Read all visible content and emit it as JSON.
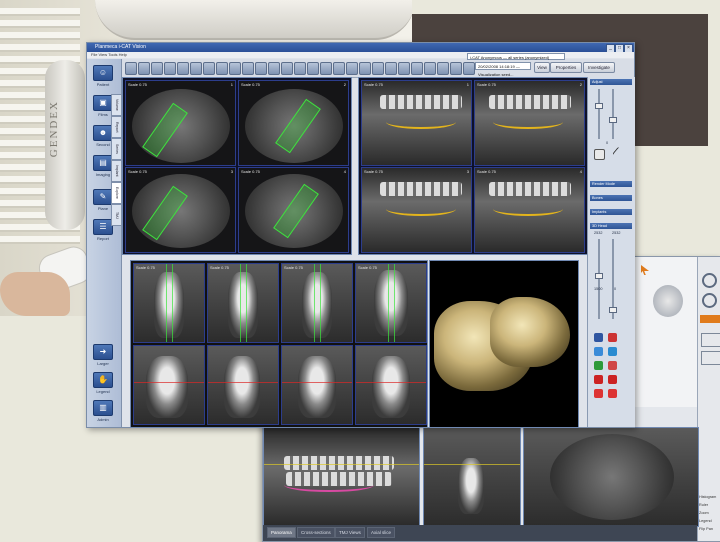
{
  "brand_text": "GENDEX",
  "app": {
    "title": "Planmeca i-CAT Vision",
    "menu": "File  View  Tools  Help",
    "patient_dropdown": "i-CAT Anonymous  —  all series (anonymized)",
    "series_dropdown": "20/02/2008 14:18:19 — Visualization seed...",
    "buttons": {
      "view": "View",
      "properties": "Properties",
      "investigate": "Investigate"
    }
  },
  "left_nav": {
    "items": [
      {
        "label": "Patient",
        "icon": "patient-icon"
      },
      {
        "label": "Films",
        "icon": "films-icon"
      },
      {
        "label": "Second",
        "icon": "second-icon"
      },
      {
        "label": "Imaging",
        "icon": "imaging-icon"
      },
      {
        "label": "Plane",
        "icon": "plane-icon"
      },
      {
        "label": "Report",
        "icon": "report-icon"
      }
    ],
    "vertical_tabs": [
      "Volume",
      "Report",
      "Series",
      "Implant",
      "Explore",
      "TMJ"
    ],
    "bottom_items": [
      {
        "label": "Larger",
        "icon": "larger-icon"
      },
      {
        "label": "Legend",
        "icon": "legend-icon"
      },
      {
        "label": "Admin",
        "icon": "admin-icon"
      }
    ]
  },
  "axial_cells": [
    {
      "label": "Scale 0.75",
      "num": "1"
    },
    {
      "label": "Scale 0.75",
      "num": "2"
    },
    {
      "label": "Scale 0.75",
      "num": "3"
    },
    {
      "label": "Scale 0.75",
      "num": "4"
    }
  ],
  "pano_cells": [
    {
      "label": "Scale 0.75",
      "num": "1"
    },
    {
      "label": "Scale 0.75",
      "num": "2"
    },
    {
      "label": "Scale 0.75",
      "num": "3"
    },
    {
      "label": "Scale 0.75",
      "num": "4"
    }
  ],
  "slice_cells": [
    {
      "label": "Scale 0.75"
    },
    {
      "label": "Scale 0.75"
    },
    {
      "label": "Scale 0.75"
    },
    {
      "label": "Scale 0.75"
    }
  ],
  "right_panel": {
    "sections": [
      "Adjust",
      "Render Mode",
      "Bones",
      "Implants",
      "3D Head"
    ],
    "values": {
      "top": "0",
      "mid_a": "2532",
      "mid_b": "2532",
      "bottom_a": "1500",
      "bottom_b": "0"
    }
  },
  "second_window": {
    "tabs": [
      "Panorama",
      "Cross-sections",
      "TMJ Views",
      "Axial slice"
    ],
    "side_labels": [
      "Histogram",
      "Ruler",
      "Zoom",
      "Legend",
      "Flip Pan"
    ]
  },
  "colors": {
    "accent_blue": "#2a4f96",
    "nerve_yellow": "#e3b41c",
    "implant_green": "#3ee23e"
  }
}
